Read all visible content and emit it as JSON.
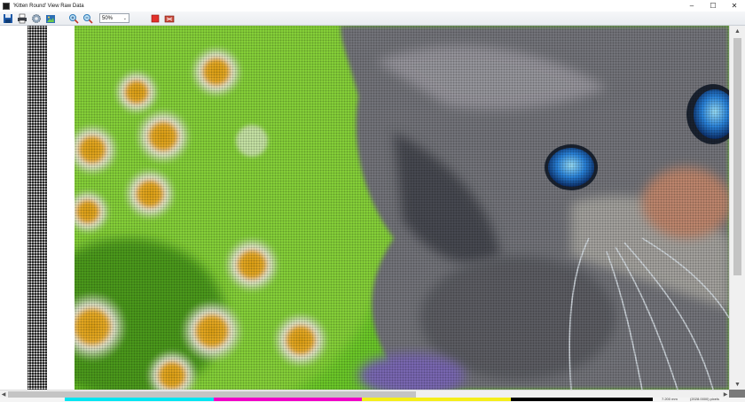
{
  "window": {
    "title": "'Kitten Round' View Raw Data",
    "controls": {
      "minimize": "–",
      "maximize": "☐",
      "close": "✕"
    }
  },
  "toolbar": {
    "zoom": "50%",
    "zoom_arrow": "⌄",
    "buttons": [
      "save-icon",
      "print-icon",
      "settings-gear-icon",
      "export-image-icon",
      "zoom-in-icon",
      "zoom-out-icon",
      "stop-icon",
      "delete-icon"
    ]
  },
  "separations": {
    "colors": [
      "#00e5f2",
      "#f000c8",
      "#f5ee1a",
      "#000000"
    ]
  },
  "status": {
    "size": "7.200 mm",
    "dimensions": "(2028.0000) pixels"
  },
  "scrollbars": {
    "up": "▲",
    "down": "▼",
    "left": "◀",
    "right": "▶"
  }
}
